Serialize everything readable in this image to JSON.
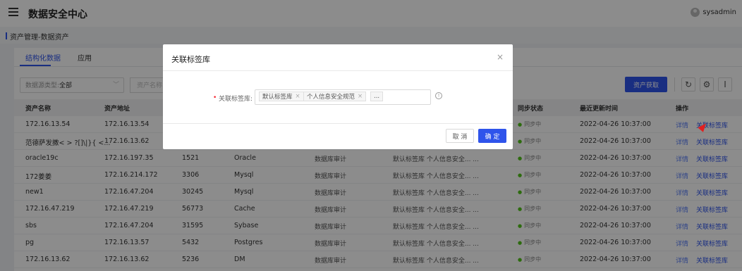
{
  "header": {
    "title": "数据安全中心",
    "user": "sysadmin"
  },
  "breadcrumb": "资产管理-数据资产",
  "tabs": [
    {
      "label": "结构化数据",
      "active": true
    },
    {
      "label": "应用",
      "active": false
    }
  ],
  "filters": {
    "source_type_label": "数据源类型:",
    "source_type_value": "全部",
    "search_placeholder": "资产名称"
  },
  "toolbar": {
    "fetch_label": "资产获取"
  },
  "table": {
    "columns": [
      "资产名称",
      "资产地址",
      "",
      "",
      "",
      "",
      "同步状态",
      "最近更新时间",
      "操作"
    ],
    "rows": [
      [
        "172.16.13.54",
        "172.16.13.54",
        "",
        "",
        "",
        "",
        "同步中",
        "2022-04-26 10:37:00"
      ],
      [
        "范德萨发撒< > ?[]\\|}{ <...",
        "172.16.13.62",
        "",
        "",
        "",
        "",
        "同步中",
        "2022-04-26 10:37:00"
      ],
      [
        "oracle19c",
        "172.16.197.35",
        "1521",
        "Oracle",
        "数据库审计",
        "默认标签库 个人信息安全... ...",
        "同步中",
        "2022-04-26 10:37:00"
      ],
      [
        "172姜姜",
        "172.16.214.172",
        "3306",
        "Mysql",
        "数据库审计",
        "默认标签库 个人信息安全... ...",
        "同步中",
        "2022-04-26 10:37:00"
      ],
      [
        "new1",
        "172.16.47.204",
        "30245",
        "Mysql",
        "数据库审计",
        "默认标签库 个人信息安全... ...",
        "同步中",
        "2022-04-26 10:37:00"
      ],
      [
        "172.16.47.219",
        "172.16.47.219",
        "56773",
        "Cache",
        "数据库审计",
        "默认标签库 个人信息安全... ...",
        "同步中",
        "2022-04-26 10:37:00"
      ],
      [
        "sbs",
        "172.16.47.204",
        "31595",
        "Sybase",
        "数据库审计",
        "默认标签库 个人信息安全... ...",
        "同步中",
        "2022-04-26 10:37:00"
      ],
      [
        "pg",
        "172.16.13.57",
        "5432",
        "Postgres",
        "数据库审计",
        "默认标签库 个人信息安全... ...",
        "同步中",
        "2022-04-26 10:37:00"
      ],
      [
        "172.16.13.62",
        "172.16.13.62",
        "5236",
        "DM",
        "数据库审计",
        "默认标签库 个人信息安全... ...",
        "同步中",
        "2022-04-26 10:37:00"
      ]
    ],
    "actions": {
      "detail": "详情",
      "link": "关联标签库"
    }
  },
  "modal": {
    "title": "关联标签库",
    "close": "×",
    "field_label": "关联标签库:",
    "tags": [
      "默认标签库",
      "个人信息安全规范",
      "..."
    ],
    "tag_close": "×",
    "info": "!",
    "cancel": "取 消",
    "ok": "确 定"
  },
  "colors": {
    "primary": "#2f54eb",
    "status_green": "#52c41a"
  }
}
